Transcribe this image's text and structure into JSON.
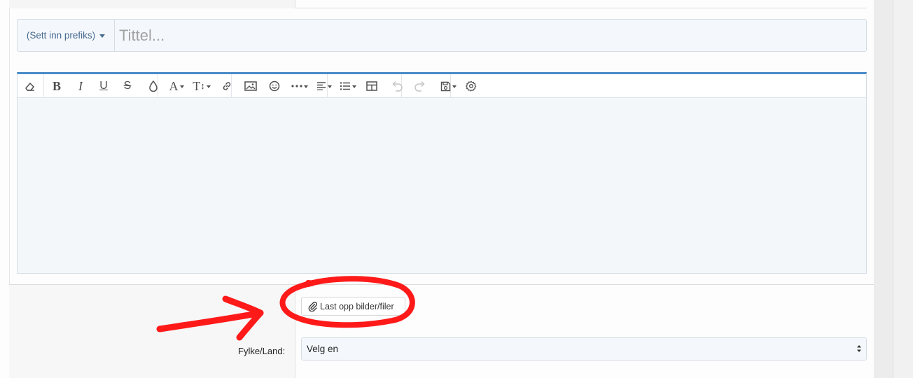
{
  "form": {
    "prefix_label": "(Sett inn prefiks)",
    "title_placeholder": "Tittel..."
  },
  "editor": {
    "toolbar_buttons": [
      "eraser-icon",
      "bold-icon",
      "italic-icon",
      "underline-icon",
      "strikethrough-icon",
      "color-drop-icon",
      "font-family-icon",
      "font-size-icon",
      "link-icon",
      "image-icon",
      "emoji-icon",
      "more-icon",
      "align-icon",
      "list-icon",
      "table-icon",
      "undo-icon",
      "redo-icon",
      "drafts-icon",
      "settings-icon"
    ],
    "bold_glyph": "B",
    "italic_glyph": "I",
    "underline_glyph": "U",
    "strike_glyph": "S",
    "font_glyph": "A",
    "size_glyph": "T"
  },
  "attachments": {
    "upload_label": "Last opp bilder/filer"
  },
  "fields": {
    "county_label": "Fylke/Land:",
    "county_value": "Velg en"
  },
  "annotation": {
    "color": "#ff1a1a",
    "shapes": [
      "arrow",
      "circle"
    ]
  },
  "colors": {
    "editor_accent": "#4a8cc8",
    "link_blue": "#47698f"
  }
}
